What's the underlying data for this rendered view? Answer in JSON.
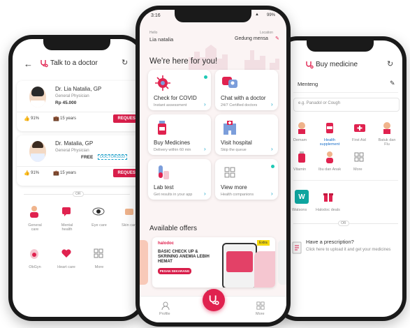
{
  "left": {
    "title": "Talk to a doctor",
    "doctors": [
      {
        "name": "Dr. Lia Natalia, GP",
        "role": "General Physician",
        "price": "Rp 45.000",
        "rating": "91%",
        "experience": "15 years",
        "button": "REQUEST"
      },
      {
        "name": "Dr. Matalia, GP",
        "role": "General Physician",
        "free": "FREE",
        "code": "DOCTOR3333",
        "rating": "91%",
        "experience": "15 years",
        "button": "REQUEST"
      }
    ],
    "or": "OR",
    "categories": [
      "General care",
      "Mental health",
      "Eye care",
      "Skin care",
      "ObGyn",
      "Heart care",
      "More"
    ]
  },
  "center": {
    "time": "3:16",
    "battery": "99%",
    "hello_label": "Hello",
    "user": "Lia natalia",
    "location_label": "Location",
    "location": "Gedung mensa",
    "hero": "We're here for you!",
    "tiles": [
      {
        "title": "Check for COVID",
        "sub": "Instant assessment"
      },
      {
        "title": "Chat with a doctor",
        "sub": "24/7 Certified doctors"
      },
      {
        "title": "Buy Medicines",
        "sub": "Delivery within 60 min"
      },
      {
        "title": "Visit hospital",
        "sub": "Skip the queue"
      },
      {
        "title": "Lab test",
        "sub": "Get results in your app"
      },
      {
        "title": "View more",
        "sub": "Health companions"
      }
    ],
    "offers_title": "Available offers",
    "offer": {
      "brand": "halodoc",
      "badge": "Extra",
      "headline": "BASIC CHECK UP & SKRINING ANEMIA LEBIH HEMAT",
      "cta": "PESAN SEKARANG"
    },
    "nav": {
      "profile": "Profile",
      "more": "More"
    }
  },
  "right": {
    "title": "Buy medicine",
    "location": "Menteng",
    "search_placeholder": "e.g. Panadol or Cough",
    "cats_row1": [
      "Demam",
      "Health supplement",
      "First Aid",
      "Batuk dan Flu"
    ],
    "cats_row2": [
      "Vitamin",
      "Ibu dan Anak",
      "More"
    ],
    "brands": [
      "Watsons",
      "Halodoc deals"
    ],
    "or": "OR",
    "prescription_title": "Have a prescription?",
    "prescription_sub": "Click here to upload it and get your medicines"
  }
}
